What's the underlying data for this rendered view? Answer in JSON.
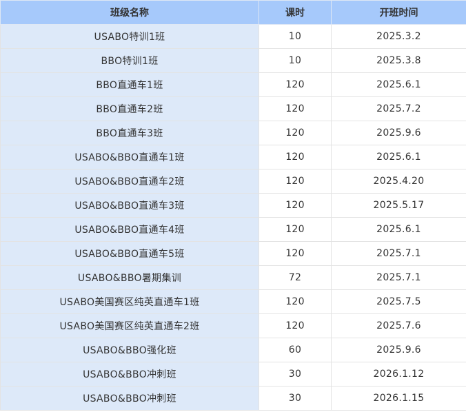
{
  "table": {
    "headers": {
      "name": "班级名称",
      "hours": "课时",
      "start": "开班时间"
    },
    "rows": [
      {
        "name": "USABO特训1班",
        "hours": "10",
        "start": "2025.3.2"
      },
      {
        "name": "BBO特训1班",
        "hours": "10",
        "start": "2025.3.8"
      },
      {
        "name": "BBO直通车1班",
        "hours": "120",
        "start": "2025.6.1"
      },
      {
        "name": "BBO直通车2班",
        "hours": "120",
        "start": "2025.7.2"
      },
      {
        "name": "BBO直通车3班",
        "hours": "120",
        "start": "2025.9.6"
      },
      {
        "name": "USABO&BBO直通车1班",
        "hours": "120",
        "start": "2025.6.1"
      },
      {
        "name": "USABO&BBO直通车2班",
        "hours": "120",
        "start": "2025.4.20"
      },
      {
        "name": "USABO&BBO直通车3班",
        "hours": "120",
        "start": "2025.5.17"
      },
      {
        "name": "USABO&BBO直通车4班",
        "hours": "120",
        "start": "2025.6.1"
      },
      {
        "name": "USABO&BBO直通车5班",
        "hours": "120",
        "start": "2025.7.1"
      },
      {
        "name": "USABO&BBO暑期集训",
        "hours": "72",
        "start": "2025.7.1"
      },
      {
        "name": "USABO美国赛区纯英直通车1班",
        "hours": "120",
        "start": "2025.7.5"
      },
      {
        "name": "USABO美国赛区纯英直通车2班",
        "hours": "120",
        "start": "2025.7.6"
      },
      {
        "name": "USABO&BBO强化班",
        "hours": "60",
        "start": "2025.9.6"
      },
      {
        "name": "USABO&BBO冲刺班",
        "hours": "30",
        "start": "2026.1.12"
      },
      {
        "name": "USABO&BBO冲刺班",
        "hours": "30",
        "start": "2026.1.15"
      }
    ]
  }
}
